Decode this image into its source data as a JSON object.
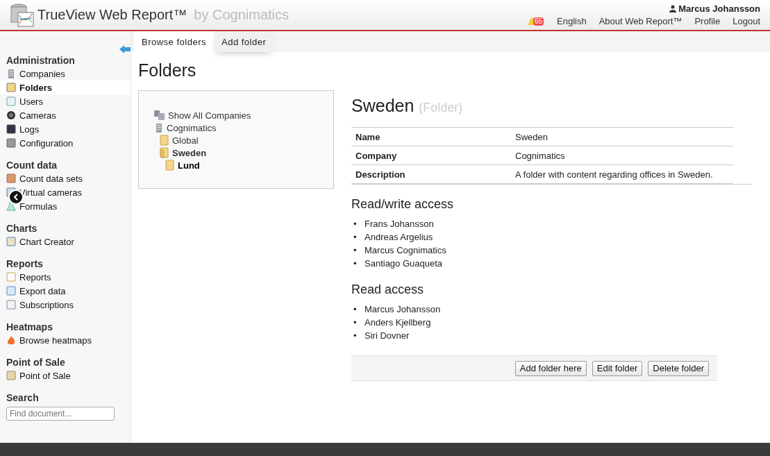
{
  "header": {
    "title": "TrueView Web Report™",
    "subtitle": "by Cognimatics",
    "user": "Marcus Johansson",
    "alert_count": "65",
    "links": [
      "English",
      "About Web Report™",
      "Profile",
      "Logout"
    ]
  },
  "tabs": [
    {
      "label": "Browse folders",
      "selected": true
    },
    {
      "label": "Add folder",
      "selected": false
    }
  ],
  "sidebar": {
    "sections": [
      {
        "title": "Administration",
        "items": [
          {
            "label": "Companies",
            "selected": false
          },
          {
            "label": "Folders",
            "selected": true
          },
          {
            "label": "Users",
            "selected": false
          },
          {
            "label": "Cameras",
            "selected": false
          },
          {
            "label": "Logs",
            "selected": false
          },
          {
            "label": "Configuration",
            "selected": false
          }
        ]
      },
      {
        "title": "Count data",
        "items": [
          {
            "label": "Count data sets",
            "selected": false
          },
          {
            "label": "Virtual cameras",
            "selected": false
          },
          {
            "label": "Formulas",
            "selected": false
          }
        ]
      },
      {
        "title": "Charts",
        "items": [
          {
            "label": "Chart Creator",
            "selected": false
          }
        ]
      },
      {
        "title": "Reports",
        "items": [
          {
            "label": "Reports",
            "selected": false
          },
          {
            "label": "Export data",
            "selected": false
          },
          {
            "label": "Subscriptions",
            "selected": false
          }
        ]
      },
      {
        "title": "Heatmaps",
        "items": [
          {
            "label": "Browse heatmaps",
            "selected": false
          }
        ]
      },
      {
        "title": "Point of Sale",
        "items": [
          {
            "label": "Point of Sale",
            "selected": false
          }
        ]
      }
    ],
    "search": {
      "title": "Search",
      "placeholder": "Find document..."
    }
  },
  "page_title": "Folders",
  "tree": [
    {
      "kind": "companies",
      "label": "Show All Companies",
      "selected": false
    },
    {
      "kind": "company",
      "label": "Cognimatics",
      "selected": false,
      "children": [
        {
          "kind": "folder",
          "label": "Global",
          "selected": false,
          "expanded": false
        },
        {
          "kind": "folder",
          "label": "Sweden",
          "selected": false,
          "expanded": true,
          "children": [
            {
              "kind": "folder",
              "label": "Lund",
              "selected": true,
              "expanded": false
            }
          ]
        }
      ]
    }
  ],
  "detail": {
    "title": "Sweden",
    "type": "(Folder)",
    "properties": [
      {
        "name": "Name",
        "value": "Sweden"
      },
      {
        "name": "Company",
        "value": "Cognimatics"
      },
      {
        "name": "Description",
        "value": "A folder with content regarding offices in Sweden."
      }
    ],
    "access": [
      {
        "title": "Read/write access",
        "bullet": "•",
        "users": [
          "Frans Johansson",
          "Andreas Argelius",
          "Marcus Cognimatics",
          "Santiago Guaqueta"
        ]
      },
      {
        "title": "Read access",
        "bullet": "•",
        "users": [
          "Marcus Johansson",
          "Anders Kjellberg",
          "Siri Dovner"
        ]
      }
    ],
    "buttons": [
      "Add folder here",
      "Edit folder",
      "Delete folder"
    ]
  }
}
